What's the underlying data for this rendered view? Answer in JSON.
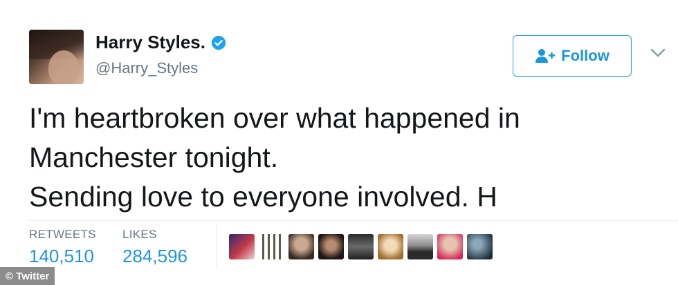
{
  "user": {
    "name": "Harry Styles.",
    "handle": "@Harry_Styles",
    "verified": true
  },
  "follow_button": {
    "label": "Follow",
    "icon": "add-person-icon"
  },
  "tweet": {
    "lines": [
      "I'm heartbroken over what happened in",
      "Manchester tonight.",
      "Sending love to everyone involved. H"
    ]
  },
  "stats": {
    "retweets_label": "RETWEETS",
    "retweets_value": "140,510",
    "likes_label": "LIKES",
    "likes_value": "284,596"
  },
  "likers": {
    "count_shown": 9
  },
  "credit": "© Twitter",
  "colors": {
    "accent": "#1da1f2",
    "link": "#1b95e0",
    "secondary_text": "#657786"
  }
}
